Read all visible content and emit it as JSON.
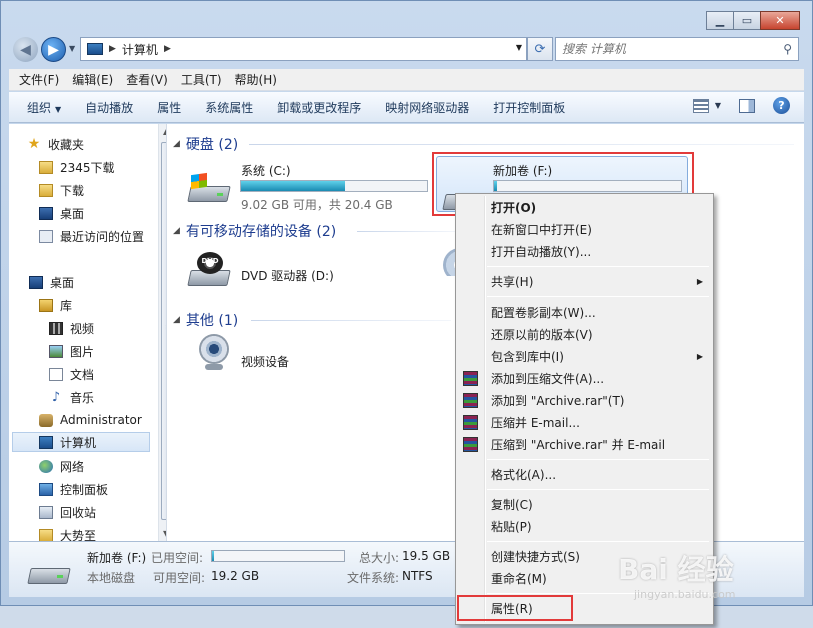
{
  "address": {
    "location": "计算机"
  },
  "search": {
    "placeholder": "搜索 计算机"
  },
  "menu": [
    "文件(F)",
    "编辑(E)",
    "查看(V)",
    "工具(T)",
    "帮助(H)"
  ],
  "toolbar": {
    "organize": "组织",
    "items": [
      "自动播放",
      "属性",
      "系统属性",
      "卸载或更改程序",
      "映射网络驱动器",
      "打开控制面板"
    ]
  },
  "sidebar": {
    "favorites": "收藏夹",
    "fav_items": [
      "2345下载",
      "下载",
      "桌面",
      "最近访问的位置"
    ],
    "desktop": "桌面",
    "library": "库",
    "lib_items": [
      "视频",
      "图片",
      "文档",
      "音乐"
    ],
    "administrator": "Administrator",
    "computer": "计算机",
    "network": "网络",
    "control_panel": "控制面板",
    "recycle": "回收站",
    "dashizhi": "大势至"
  },
  "groups": {
    "hdd": "硬盘 (2)",
    "removable": "有可移动存储的设备 (2)",
    "other": "其他 (1)"
  },
  "drives": {
    "c": {
      "name": "系统 (C:)",
      "info": "9.02 GB 可用，共 20.4 GB",
      "used_fraction": 0.56
    },
    "f": {
      "name": "新加卷 (F:)",
      "used_fraction": 0.015
    },
    "dvd": {
      "name": "DVD 驱动器 (D:)",
      "icon_text": "DVD"
    },
    "cam": {
      "name": "视频设备"
    }
  },
  "status": {
    "name": "新加卷 (F:)",
    "type": "本地磁盘",
    "used_label": "已用空间:",
    "free_label": "可用空间:",
    "free_value": "19.2 GB",
    "total_label": "总大小:",
    "total_value": "19.5 GB",
    "fs_label": "文件系统:",
    "fs_value": "NTFS",
    "used_fraction": 0.015
  },
  "context_menu": {
    "open": "打开(O)",
    "open_new_window": "在新窗口中打开(E)",
    "open_autoplay": "打开自动播放(Y)...",
    "share": "共享(H)",
    "shadow_copy": "配置卷影副本(W)...",
    "restore": "还原以前的版本(V)",
    "include_library": "包含到库中(I)",
    "add_archive": "添加到压缩文件(A)...",
    "add_to_rar": "添加到 \"Archive.rar\"(T)",
    "compress_email": "压缩并 E-mail...",
    "compress_rar_email": "压缩到 \"Archive.rar\" 并 E-mail",
    "format": "格式化(A)...",
    "copy": "复制(C)",
    "paste": "粘贴(P)",
    "shortcut": "创建快捷方式(S)",
    "rename": "重命名(M)",
    "properties": "属性(R)"
  },
  "watermark": {
    "main": "Bai 经验",
    "sub": "jingyan.baidu.com"
  }
}
